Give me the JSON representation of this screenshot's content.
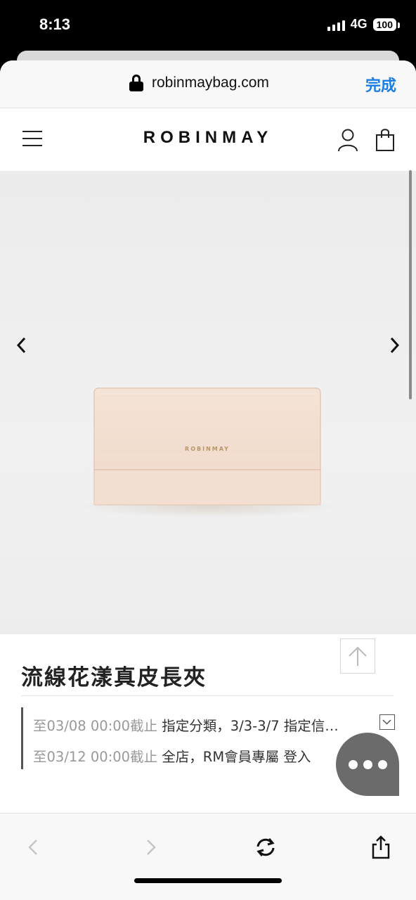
{
  "status_bar": {
    "time": "8:13",
    "network": "4G",
    "battery": "100"
  },
  "browser": {
    "url": "robinmaybag.com",
    "done_label": "完成"
  },
  "site": {
    "brand": "ROBINMAY"
  },
  "product": {
    "image": {
      "logo_text": "ROBINMAY",
      "colors": {
        "wallet": "#f2dfd2",
        "wallet_edge": "#e6cbb8",
        "background": "#efefef"
      }
    },
    "title": "流線花漾真皮長夾"
  },
  "promotions": [
    {
      "date": "至03/08 00:00截止",
      "text": "指定分類，3/3-3/7 指定信…"
    },
    {
      "date": "至03/12 00:00截止",
      "text": "全店，RM會員專屬 登入"
    }
  ],
  "icons": {
    "menu": "hamburger-icon",
    "account": "user-icon",
    "cart": "shopping-bag-icon",
    "prev": "chevron-left-icon",
    "next": "chevron-right-icon",
    "scroll_top": "arrow-up-icon",
    "expand": "chevron-down-icon",
    "chat": "more-dots-icon",
    "refresh": "refresh-icon",
    "share": "share-icon"
  },
  "colors": {
    "accent": "#1a7ee6",
    "chat_bubble": "#6b6b6b",
    "text": "#222222",
    "muted_text": "#999999"
  }
}
